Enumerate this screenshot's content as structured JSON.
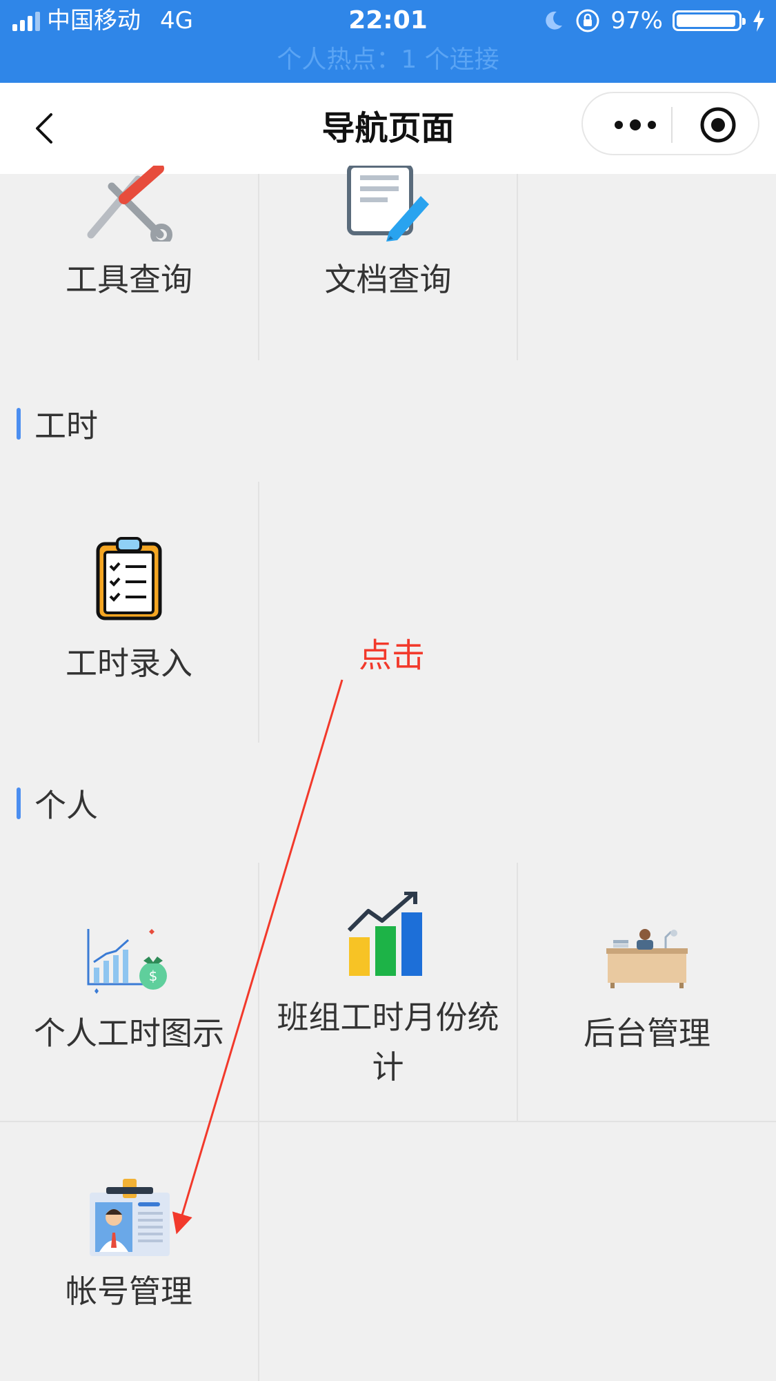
{
  "status_bar": {
    "carrier": "中国移动",
    "network": "4G",
    "time": "22:01",
    "battery": "97%",
    "battery_level": 0.97,
    "hotspot": "个人热点：1 个连接",
    "color": "#2f86e8"
  },
  "nav": {
    "title": "导航页面",
    "back_icon": "chevron-left-icon",
    "more_icon": "more-dots-icon",
    "close_icon": "target-circle-icon"
  },
  "top_items": [
    {
      "label": "工具查询",
      "icon": "tools-icon"
    },
    {
      "label": "文档查询",
      "icon": "document-edit-icon"
    }
  ],
  "sections": [
    {
      "title": "工时",
      "items": [
        {
          "label": "工时录入",
          "icon": "clipboard-checklist-icon"
        }
      ]
    },
    {
      "title": "个人",
      "items": [
        {
          "label": "个人工时图示",
          "icon": "chart-money-icon"
        },
        {
          "label": "班组工时月份统计",
          "icon": "bar-chart-trend-icon"
        },
        {
          "label": "后台管理",
          "icon": "admin-desk-icon"
        },
        {
          "label": "帐号管理",
          "icon": "id-badge-icon"
        }
      ]
    }
  ],
  "annotation": {
    "text": "点击",
    "color": "#f2392b"
  }
}
